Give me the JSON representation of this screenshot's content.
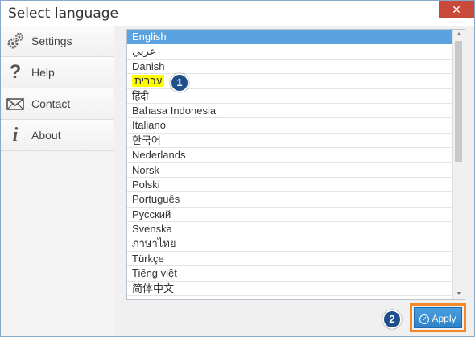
{
  "window": {
    "title": "Select language",
    "close_glyph": "✕"
  },
  "sidebar": {
    "items": [
      {
        "label": "Settings",
        "icon": "gears-icon"
      },
      {
        "label": "Help",
        "icon": "question-icon"
      },
      {
        "label": "Contact",
        "icon": "envelope-icon"
      },
      {
        "label": "About",
        "icon": "info-icon"
      }
    ]
  },
  "languages": [
    "English",
    "عربي",
    "Danish",
    "עברית",
    "हिंदी",
    "Bahasa Indonesia",
    "Italiano",
    "한국어",
    "Nederlands",
    "Norsk",
    "Polski",
    "Português",
    "Русский",
    "Svenska",
    "ภาษาไทย",
    "Türkçe",
    "Tiếng việt",
    "简体中文"
  ],
  "selected_language": "English",
  "highlighted_language": "עברית",
  "annotations": {
    "badge1": "1",
    "badge2": "2"
  },
  "apply_button": {
    "label": "Apply"
  },
  "colors": {
    "selection": "#5ba3e0",
    "highlight": "#ffff00",
    "badge": "#1e4f8a",
    "callout": "#f08a28"
  }
}
